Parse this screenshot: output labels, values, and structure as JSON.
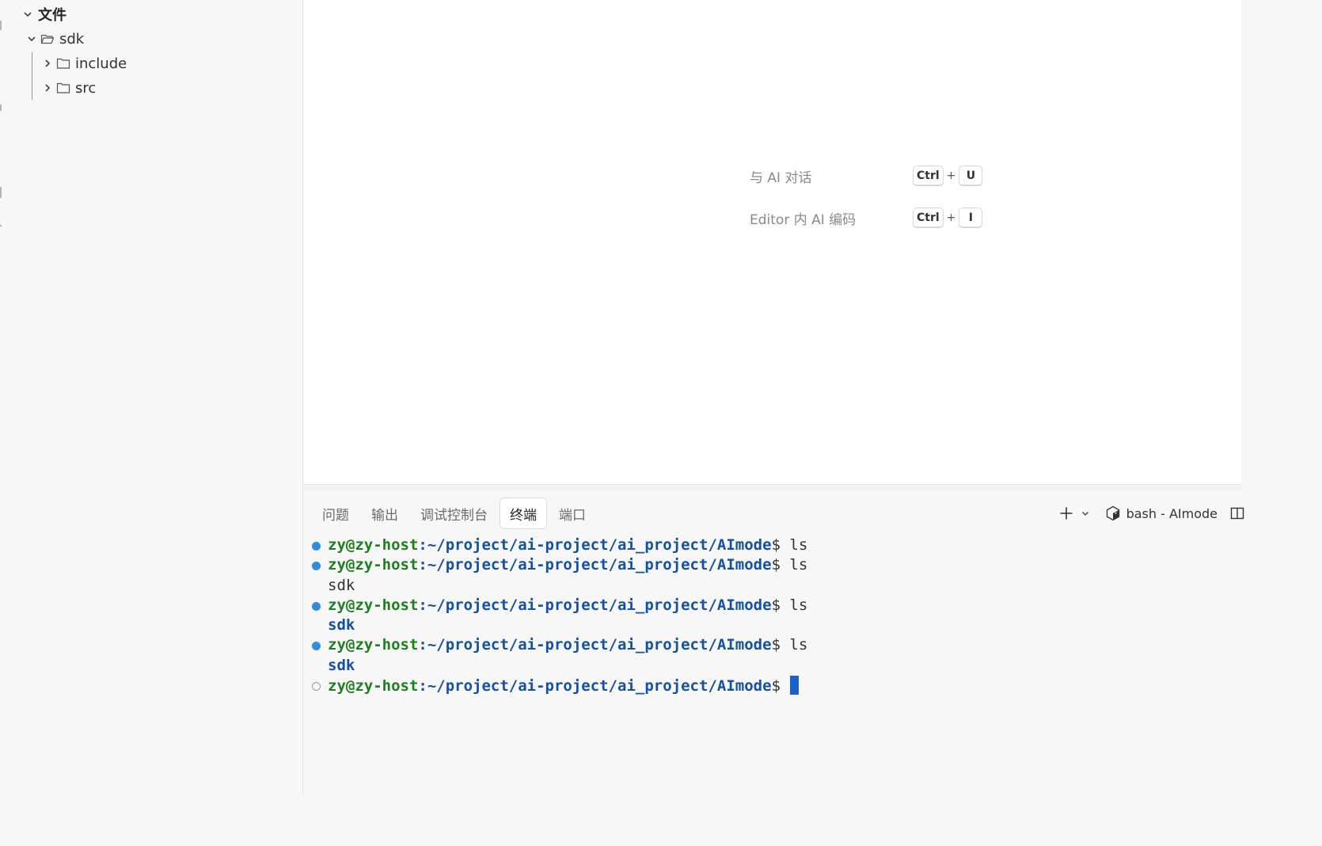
{
  "explorer": {
    "root_label": "文件",
    "items": [
      {
        "label": "sdk",
        "expanded": true
      },
      {
        "label": "include",
        "expanded": false
      },
      {
        "label": "src",
        "expanded": false
      }
    ]
  },
  "editor": {
    "shortcuts": [
      {
        "label": "与 AI 对话",
        "keys": [
          "Ctrl",
          "+",
          "U"
        ]
      },
      {
        "label": "Editor 内 AI 编码",
        "keys": [
          "Ctrl",
          "+",
          "I"
        ]
      }
    ]
  },
  "panel": {
    "tabs": [
      {
        "label": "问题",
        "active": false
      },
      {
        "label": "输出",
        "active": false
      },
      {
        "label": "调试控制台",
        "active": false
      },
      {
        "label": "终端",
        "active": true
      },
      {
        "label": "端口",
        "active": false
      }
    ],
    "terminal_name": "bash - AImode"
  },
  "terminal": {
    "prompt_user": "zy@zy-host",
    "prompt_path": ":~/project/ai-project/ai_project/AImode",
    "prompt_sign": "$ ",
    "lines": [
      {
        "kind": "prompt",
        "status": "done",
        "cmd": "ls"
      },
      {
        "kind": "prompt",
        "status": "done",
        "cmd": "ls"
      },
      {
        "kind": "output",
        "style": "plain",
        "text": "sdk"
      },
      {
        "kind": "prompt",
        "status": "done",
        "cmd": "ls"
      },
      {
        "kind": "output",
        "style": "dir",
        "text": "sdk"
      },
      {
        "kind": "prompt",
        "status": "done",
        "cmd": "ls"
      },
      {
        "kind": "output",
        "style": "dir",
        "text": "sdk"
      },
      {
        "kind": "prompt",
        "status": "pending",
        "cmd": ""
      }
    ]
  },
  "colors": {
    "prompt_user": "#1e7f1e",
    "prompt_path": "#1450a3",
    "status_dot": "#2f8ddf",
    "cursor": "#1763c9"
  }
}
